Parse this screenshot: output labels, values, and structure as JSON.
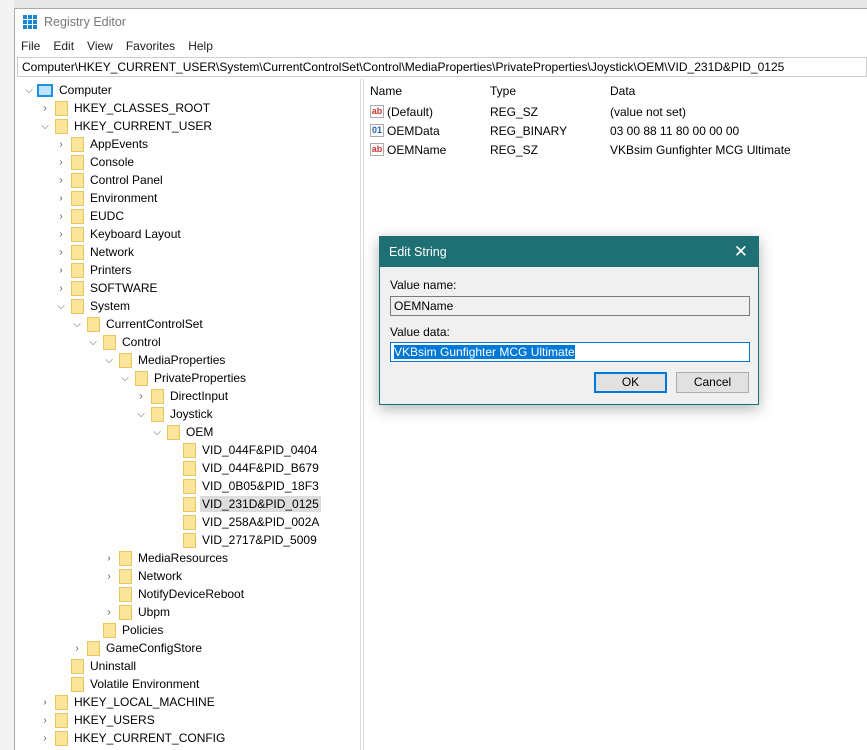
{
  "window": {
    "title": "Registry Editor"
  },
  "menu": [
    "File",
    "Edit",
    "View",
    "Favorites",
    "Help"
  ],
  "address": "Computer\\HKEY_CURRENT_USER\\System\\CurrentControlSet\\Control\\MediaProperties\\PrivateProperties\\Joystick\\OEM\\VID_231D&PID_0125",
  "tree": [
    {
      "label": "Computer",
      "level": 0,
      "state": "open",
      "icon": "computer"
    },
    {
      "label": "HKEY_CLASSES_ROOT",
      "level": 1,
      "state": "closed"
    },
    {
      "label": "HKEY_CURRENT_USER",
      "level": 1,
      "state": "open"
    },
    {
      "label": "AppEvents",
      "level": 2,
      "state": "closed"
    },
    {
      "label": "Console",
      "level": 2,
      "state": "closed"
    },
    {
      "label": "Control Panel",
      "level": 2,
      "state": "closed"
    },
    {
      "label": "Environment",
      "level": 2,
      "state": "closed"
    },
    {
      "label": "EUDC",
      "level": 2,
      "state": "closed"
    },
    {
      "label": "Keyboard Layout",
      "level": 2,
      "state": "closed"
    },
    {
      "label": "Network",
      "level": 2,
      "state": "closed"
    },
    {
      "label": "Printers",
      "level": 2,
      "state": "closed"
    },
    {
      "label": "SOFTWARE",
      "level": 2,
      "state": "closed"
    },
    {
      "label": "System",
      "level": 2,
      "state": "open"
    },
    {
      "label": "CurrentControlSet",
      "level": 3,
      "state": "open"
    },
    {
      "label": "Control",
      "level": 4,
      "state": "open"
    },
    {
      "label": "MediaProperties",
      "level": 5,
      "state": "open"
    },
    {
      "label": "PrivateProperties",
      "level": 6,
      "state": "open"
    },
    {
      "label": "DirectInput",
      "level": 7,
      "state": "closed"
    },
    {
      "label": "Joystick",
      "level": 7,
      "state": "open"
    },
    {
      "label": "OEM",
      "level": 8,
      "state": "open"
    },
    {
      "label": "VID_044F&PID_0404",
      "level": 9,
      "state": "none"
    },
    {
      "label": "VID_044F&PID_B679",
      "level": 9,
      "state": "none"
    },
    {
      "label": "VID_0B05&PID_18F3",
      "level": 9,
      "state": "none"
    },
    {
      "label": "VID_231D&PID_0125",
      "level": 9,
      "state": "none",
      "selected": true
    },
    {
      "label": "VID_258A&PID_002A",
      "level": 9,
      "state": "none"
    },
    {
      "label": "VID_2717&PID_5009",
      "level": 9,
      "state": "none"
    },
    {
      "label": "MediaResources",
      "level": 5,
      "state": "closed"
    },
    {
      "label": "Network",
      "level": 5,
      "state": "closed"
    },
    {
      "label": "NotifyDeviceReboot",
      "level": 5,
      "state": "none"
    },
    {
      "label": "Ubpm",
      "level": 5,
      "state": "closed"
    },
    {
      "label": "Policies",
      "level": 4,
      "state": "none"
    },
    {
      "label": "GameConfigStore",
      "level": 3,
      "state": "closed"
    },
    {
      "label": "Uninstall",
      "level": 2,
      "state": "none"
    },
    {
      "label": "Volatile Environment",
      "level": 2,
      "state": "none"
    },
    {
      "label": "HKEY_LOCAL_MACHINE",
      "level": 1,
      "state": "closed"
    },
    {
      "label": "HKEY_USERS",
      "level": 1,
      "state": "closed"
    },
    {
      "label": "HKEY_CURRENT_CONFIG",
      "level": 1,
      "state": "closed"
    }
  ],
  "columns": {
    "name": "Name",
    "type": "Type",
    "data": "Data"
  },
  "values": [
    {
      "name": "(Default)",
      "type": "REG_SZ",
      "data": "(value not set)",
      "icon": "string"
    },
    {
      "name": "OEMData",
      "type": "REG_BINARY",
      "data": "03 00 88 11 80 00 00 00",
      "icon": "binary"
    },
    {
      "name": "OEMName",
      "type": "REG_SZ",
      "data": "VKBsim Gunfighter MCG Ultimate",
      "icon": "string"
    }
  ],
  "dialog": {
    "title": "Edit String",
    "value_name_label": "Value name:",
    "value_name": "OEMName",
    "value_data_label": "Value data:",
    "value_data": "VKBsim Gunfighter MCG Ultimate",
    "ok": "OK",
    "cancel": "Cancel"
  },
  "colors": {
    "dialog_title": "#1f7074",
    "accent": "#0078d7"
  }
}
